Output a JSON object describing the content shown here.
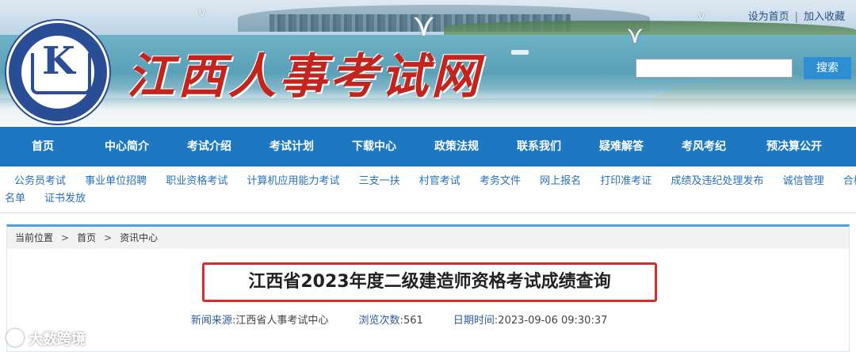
{
  "header": {
    "site_title": "江西人事考试网",
    "logo_letter": "K",
    "top_links": [
      "设为首页",
      "加入收藏"
    ],
    "top_links_separator": "|",
    "search_placeholder": "",
    "search_button": "搜索",
    "colors": {
      "title": "#c3251e",
      "logo": "#2a4e96",
      "search_button": "#2d8fd1"
    }
  },
  "main_nav": {
    "color": "#1d78c1",
    "items": [
      "首页",
      "中心简介",
      "考试介绍",
      "考试计划",
      "下载中心",
      "政策法规",
      "联系我们",
      "疑难解答",
      "考风考纪",
      "预决算公开"
    ]
  },
  "sub_nav": {
    "row1": [
      "公务员考试",
      "事业单位招聘",
      "职业资格考试",
      "计算机应用能力考试",
      "三支一扶",
      "村官考试",
      "考务文件",
      "网上报名",
      "打印准考证",
      "成绩及违纪处理发布",
      "诚信管理",
      "合格"
    ],
    "row2": [
      "名单",
      "证书发放"
    ]
  },
  "breadcrumb": {
    "label": "当前位置",
    "separator": ">",
    "items": [
      "首页",
      "资讯中心"
    ]
  },
  "article": {
    "title": "江西省2023年度二级建造师资格考试成绩查询",
    "source_label": "新闻来源:",
    "source": "江西省人事考试中心",
    "views_label": "浏览次数:",
    "views": "561",
    "date_label": "日期时间:",
    "date": "2023-09-06 09:30:37",
    "highlight_color": "#d92c2c"
  },
  "watermark": {
    "text": "大数跨境"
  }
}
